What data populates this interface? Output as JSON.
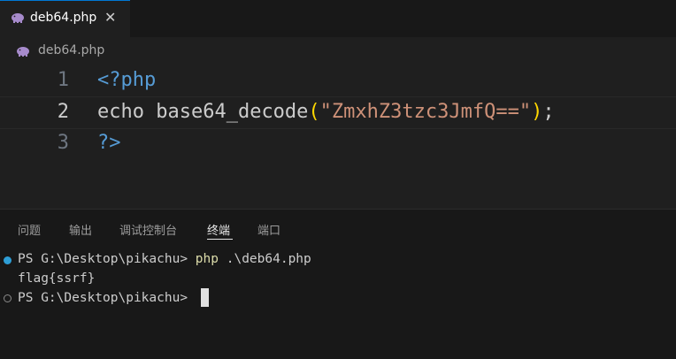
{
  "tab": {
    "filename": "deb64.php",
    "icon": "php-elephant-icon",
    "close_glyph": "✕"
  },
  "breadcrumb": {
    "filename": "deb64.php"
  },
  "editor": {
    "lines": [
      {
        "number": "1",
        "open_tag": "<?php"
      },
      {
        "number": "2",
        "keyword": "echo",
        "function": "base64_decode",
        "open_paren": "(",
        "string": "\"ZmxhZ3tzc3JmfQ==\"",
        "close_paren": ")",
        "semicolon": ";"
      },
      {
        "number": "3",
        "close_tag": "?>"
      }
    ]
  },
  "panel": {
    "tabs": [
      "问题",
      "输出",
      "调试控制台",
      "终端",
      "端口"
    ],
    "active_tab": "终端"
  },
  "terminal": {
    "prompt1": "PS G:\\Desktop\\pikachu> ",
    "cmd": "php",
    "arg": " .\\deb64.php",
    "output": "flag{ssrf}",
    "prompt2": "PS G:\\Desktop\\pikachu> "
  },
  "colors": {
    "php_icon": "#a78bcc",
    "accent": "#0078d4",
    "dot_success": "#2e9ed6"
  }
}
